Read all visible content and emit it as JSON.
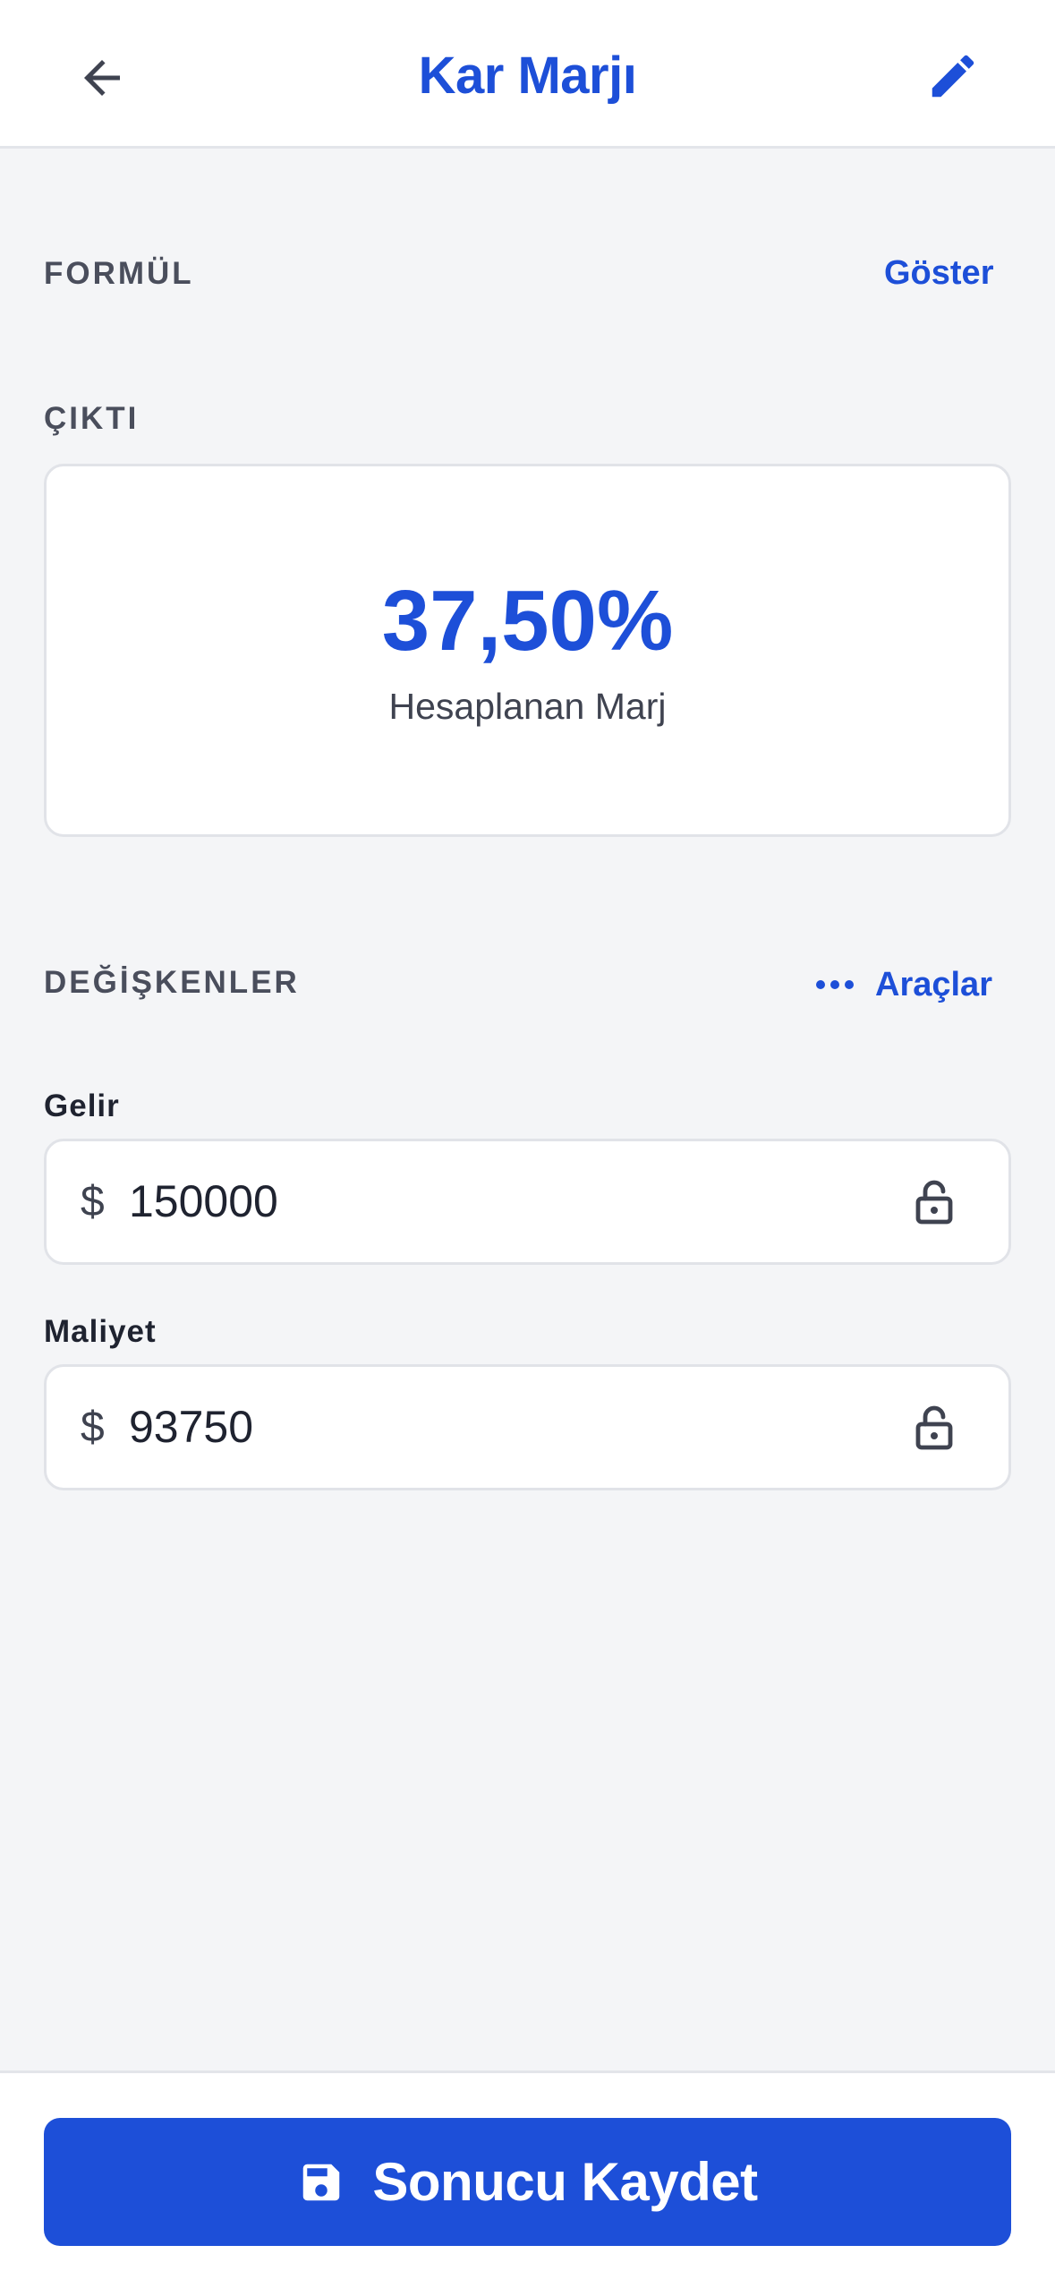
{
  "header": {
    "title": "Kar Marjı",
    "back_icon": "arrow-left-icon",
    "edit_icon": "pencil-icon"
  },
  "formula": {
    "section_label": "FORMÜL",
    "toggle_label": "Göster"
  },
  "output": {
    "section_label": "ÇIKTI",
    "value": "37,50%",
    "caption": "Hesaplanan Marj"
  },
  "variables": {
    "section_label": "DEĞİŞKENLER",
    "tools_label": "Araçlar",
    "tools_icon": "more-horizontal-icon",
    "fields": [
      {
        "label": "Gelir",
        "currency": "$",
        "value": "150000",
        "lock_icon": "unlock-icon"
      },
      {
        "label": "Maliyet",
        "currency": "$",
        "value": "93750",
        "lock_icon": "unlock-icon"
      }
    ]
  },
  "footer": {
    "save_label": "Sonucu Kaydet",
    "save_icon": "floppy-disk-icon"
  },
  "colors": {
    "accent": "#1d4fd8",
    "background": "#f4f5f7",
    "card": "#ffffff",
    "border": "#e1e3e8"
  }
}
